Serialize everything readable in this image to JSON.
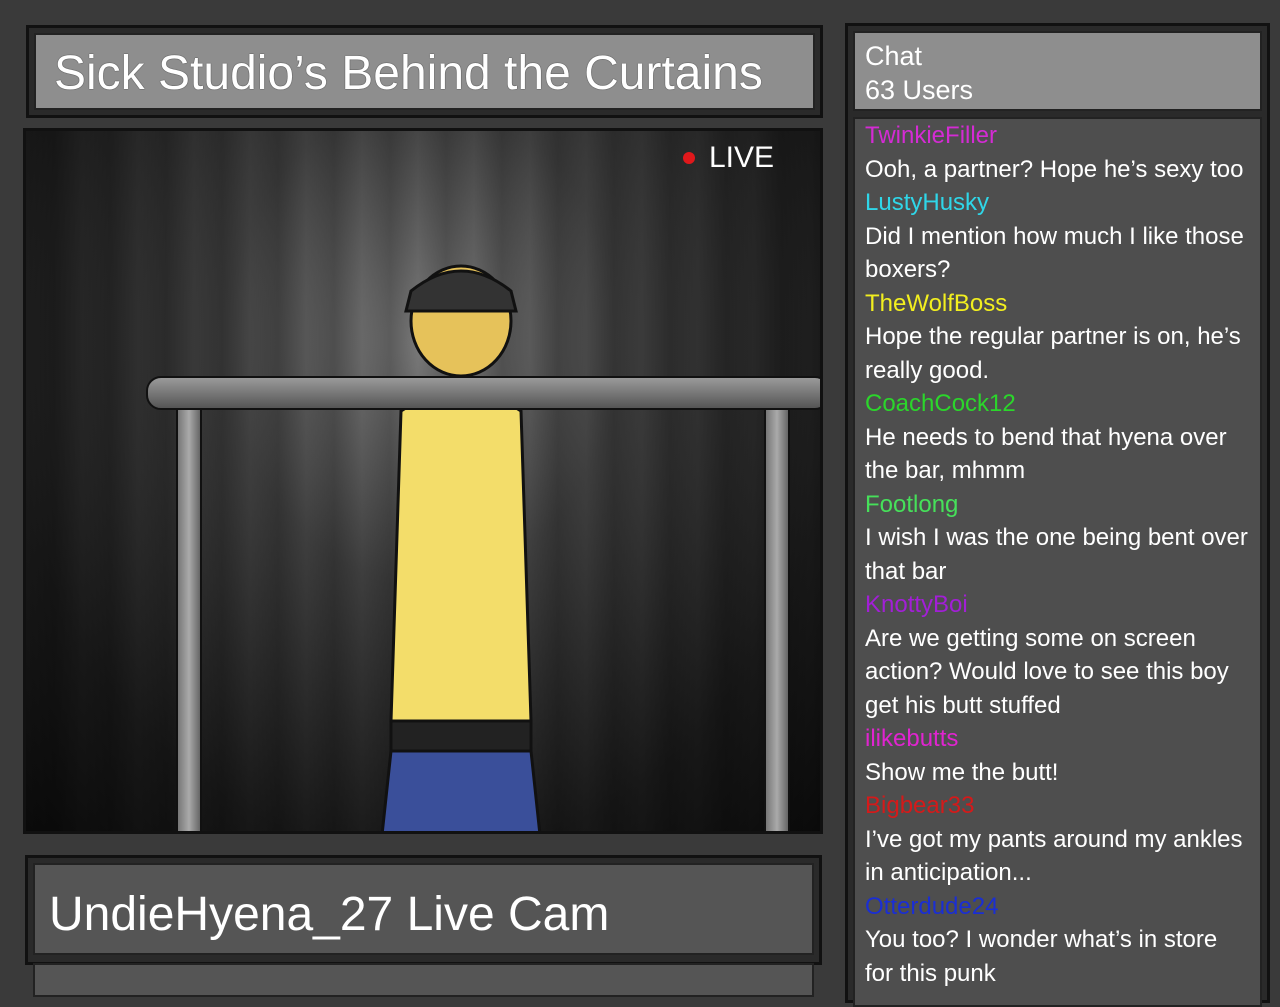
{
  "stream": {
    "title": "Sick Studio’s Behind the Curtains",
    "live_label": "LIVE",
    "live_color": "#e0181b",
    "cam_label": "UndieHyena_27 Live Cam"
  },
  "chat": {
    "title": "Chat",
    "user_count": "63 Users",
    "messages": [
      {
        "user": "TwinkieFiller",
        "color": "#d42bd4",
        "text": "Ooh, a partner?  Hope he’s sexy too"
      },
      {
        "user": "LustyHusky",
        "color": "#2fd6e8",
        "text": "Did I mention how much I like those boxers?"
      },
      {
        "user": "TheWolfBoss",
        "color": "#f2ef1f",
        "text": "Hope the regular partner is on, he’s really good."
      },
      {
        "user": "CoachCock12",
        "color": "#2bd62b",
        "text": "He needs to bend that hyena over the bar, mhmm"
      },
      {
        "user": "Footlong",
        "color": "#46e05a",
        "text": "I wish I was the one being bent over that bar"
      },
      {
        "user": "KnottyBoi",
        "color": "#a21fd6",
        "text": "Are we getting some on screen action?  Would love to see this boy get his butt stuffed"
      },
      {
        "user": "ilikebutts",
        "color": "#e024d0",
        "text": "Show me the butt!"
      },
      {
        "user": "Bigbear33",
        "color": "#d41a1a",
        "text": "I’ve got my pants around my ankles in anticipation..."
      },
      {
        "user": "Otterdude24",
        "color": "#1a2ed4",
        "text": "You too?  I wonder what’s in store for this punk"
      }
    ]
  }
}
